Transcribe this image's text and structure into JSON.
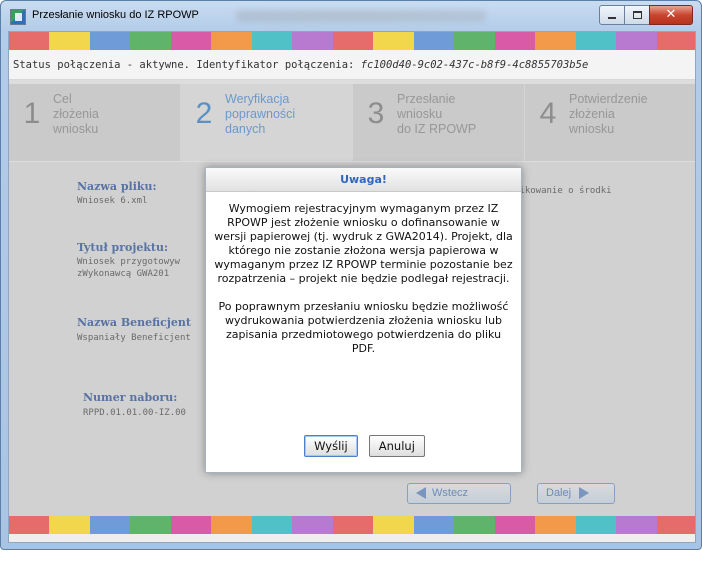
{
  "window": {
    "title": "Przesłanie wniosku do IZ RPOWP",
    "icon": "app-icon",
    "controls": {
      "minimize": "minimize-icon",
      "maximize": "maximize-icon",
      "close": "✕"
    }
  },
  "stripe_colors": [
    "#e66b6b",
    "#f2d64b",
    "#6f9bd9",
    "#5fb36a",
    "#d95ba8",
    "#f29a4a",
    "#4fc1c7",
    "#b879d1",
    "#e66b6b",
    "#f2d64b",
    "#6f9bd9",
    "#5fb36a",
    "#d95ba8",
    "#f29a4a",
    "#4fc1c7",
    "#b879d1",
    "#e66b6b"
  ],
  "status": {
    "text": "Status połączenia - aktywne. Identyfikator połączenia: ",
    "connection_id": "fc100d40-9c02-437c-b8f9-4c8855703b5e"
  },
  "steps": [
    {
      "number": "1",
      "label": "Cel\nzłożenia\nwniosku",
      "active": false
    },
    {
      "number": "2",
      "label": "Weryfikacja\npoprawności\ndanych",
      "active": true
    },
    {
      "number": "3",
      "label": "Przesłanie\nwniosku\ndo IZ RPOWP",
      "active": false
    },
    {
      "number": "4",
      "label": "Potwierdzenie\nzłożenia\nwniosku",
      "active": false
    }
  ],
  "form": {
    "file_label": "Nazwa pliku:",
    "file_value": "Wniosek 6.xml",
    "right_note": "likowanie o środki",
    "project_label": "Tytuł projektu:",
    "project_value": "Wniosek przygotowyw\nzWykonawcą GWA201",
    "beneficiary_label": "Nazwa Beneficjent",
    "beneficiary_value": "Wspaniały Beneficjent",
    "call_label": "Numer naboru:",
    "call_value": "RPPD.01.01.00-IZ.00",
    "back_label": "Wstecz",
    "next_label": "Dalej"
  },
  "dialog": {
    "title": "Uwaga!",
    "paragraph1": "Wymogiem rejestracyjnym wymaganym przez IZ RPOWP jest złożenie wniosku o dofinansowanie w wersji papierowej (tj. wydruk z GWA2014). Projekt, dla którego nie zostanie złożona wersja papierowa w wymaganym przez IZ RPOWP terminie pozostanie bez rozpatrzenia – projekt nie będzie podlegał rejestracji.",
    "paragraph2": "Po poprawnym przesłaniu wniosku będzie możliwość wydrukowania potwierdzenia złożenia wniosku lub zapisania przedmiotowego potwierdzenia do pliku PDF.",
    "send_label": "Wyślij",
    "cancel_label": "Anuluj"
  }
}
